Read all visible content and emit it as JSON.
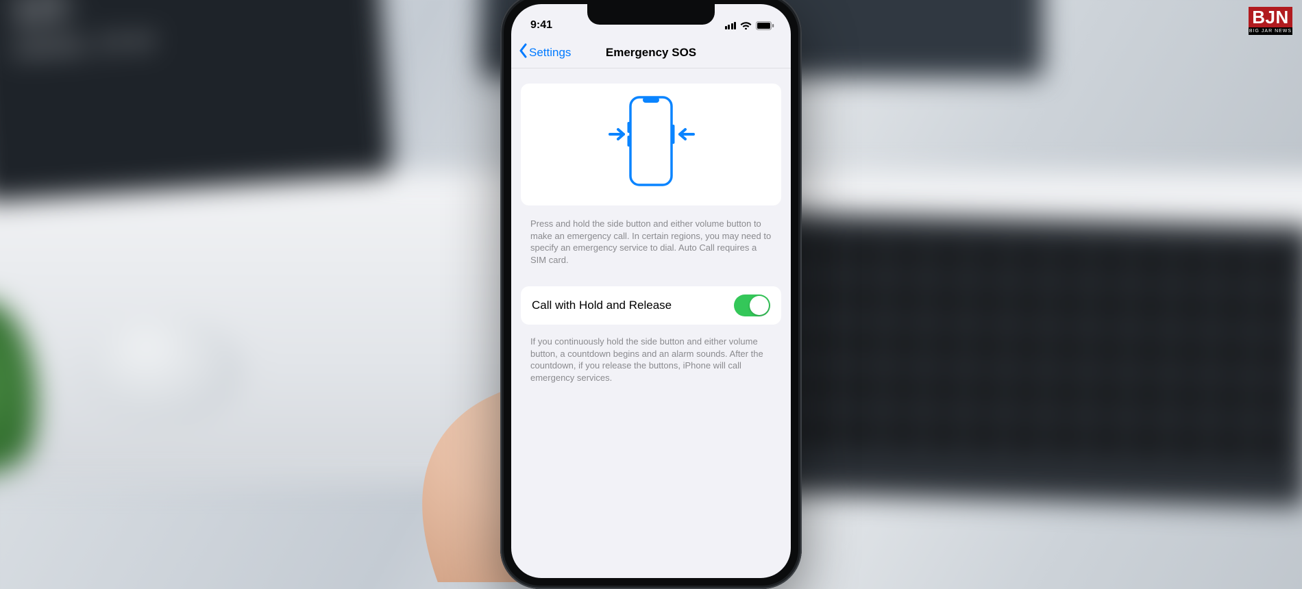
{
  "watermark": {
    "main": "BJN",
    "sub": "BIG JAR NEWS"
  },
  "bg": {
    "clock_big": "10:",
    "clock_line2": "sobota, 14 wr"
  },
  "status": {
    "time": "9:41"
  },
  "nav": {
    "back_label": "Settings",
    "title": "Emergency SOS"
  },
  "instructions": {
    "main": "Press and hold the side button and either volume button to make an emergency call. In certain regions, you may need to specify an emergency service to dial. Auto Call requires a SIM card."
  },
  "setting": {
    "hold_release_label": "Call with Hold and Release",
    "hold_release_footer": "If you continuously hold the side button and either volume button, a countdown begins and an alarm sounds. After the countdown, if you release the buttons, iPhone will call emergency services."
  }
}
